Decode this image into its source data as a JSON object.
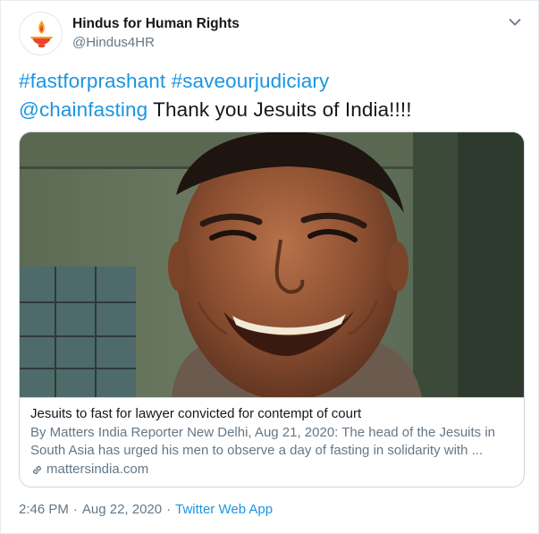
{
  "account": {
    "display_name": "Hindus for Human Rights",
    "handle": "@Hindus4HR",
    "avatar_icon": "diya-lamp-icon"
  },
  "tweet": {
    "hashtag_1": "#fastforprashant",
    "hashtag_2": "#saveourjudiciary",
    "mention": "@chainfasting",
    "text": " Thank you Jesuits of India!!!!"
  },
  "card": {
    "title": "Jesuits to fast for lawyer convicted for contempt of court",
    "description": "By Matters India Reporter New Delhi, Aug 21, 2020: The head of the Jesuits in South Asia has urged his men to observe a day of fasting in solidarity with ...",
    "domain": "mattersindia.com",
    "image_subject": "smiling man portrait"
  },
  "meta": {
    "time": "2:46 PM",
    "separator": "·",
    "date": "Aug 22, 2020",
    "source": "Twitter Web App"
  },
  "colors": {
    "link_blue": "#1b95e0",
    "secondary_text": "#657786",
    "border": "#ccd6dd"
  }
}
